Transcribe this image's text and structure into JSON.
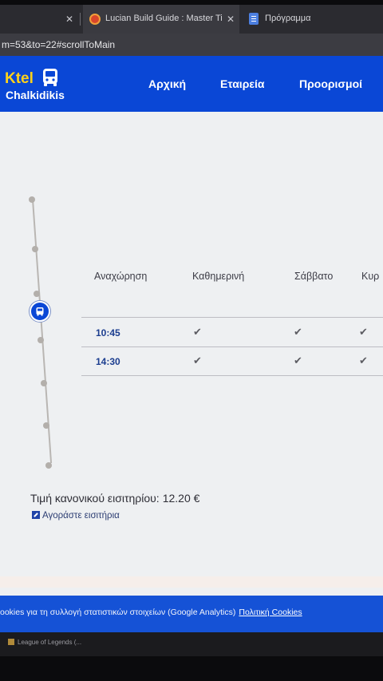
{
  "browser": {
    "tabs": [
      {
        "label": ""
      },
      {
        "label": "Lucian Build Guide : Master Tier",
        "icon": "league-of-legends-icon"
      },
      {
        "label": "Πρόγραμμα",
        "icon": "document-icon"
      }
    ],
    "close_symbol": "✕",
    "url": "m=53&to=22#scrollToMain"
  },
  "site": {
    "logo_main": "Ktel",
    "logo_sub": "Chalkidikis",
    "nav": {
      "home": "Αρχική",
      "company": "Εταιρεία",
      "destinations": "Προορισμοί"
    },
    "brand_color": "#0a47d6",
    "logo_color": "#ffd21a"
  },
  "schedule": {
    "headers": {
      "departure": "Αναχώρηση",
      "weekday": "Καθημερινή",
      "saturday": "Σάββατο",
      "sunday": "Κυρ"
    },
    "rows": [
      {
        "time": "10:45",
        "weekday": "✔",
        "saturday": "✔",
        "sunday": "✔"
      },
      {
        "time": "14:30",
        "weekday": "✔",
        "saturday": "✔",
        "sunday": "✔"
      }
    ]
  },
  "price": {
    "label": "Τιμή κανονικού εισιτηρίου:",
    "value": "12.20 €"
  },
  "buy_link": "Αγοράστε εισιτήρια",
  "cookie": {
    "text": "ookies για τη συλλογή στατιστικών στοιχείων (Google Analytics)",
    "link": "Πολιτική Cookies"
  },
  "taskbar": {
    "item": "League of Legends (..."
  }
}
